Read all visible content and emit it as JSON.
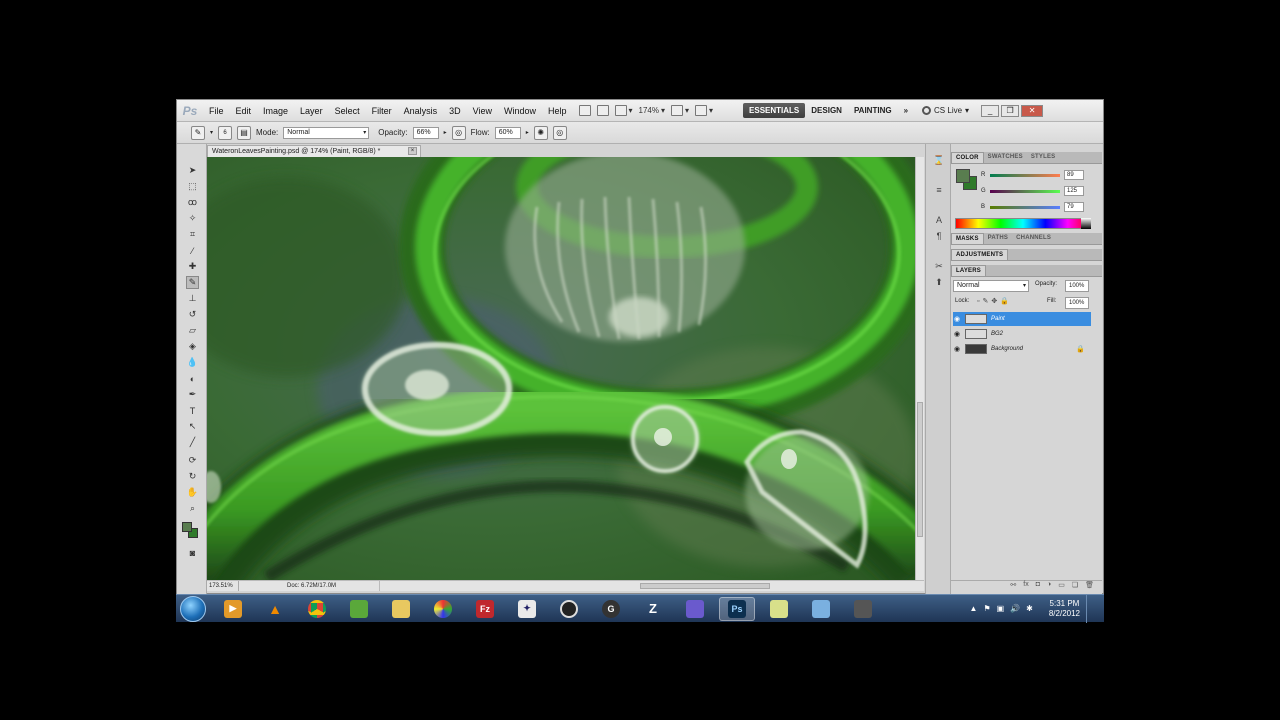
{
  "menu": {
    "logo": "Ps",
    "items": [
      "File",
      "Edit",
      "Image",
      "Layer",
      "Select",
      "Filter",
      "Analysis",
      "3D",
      "View",
      "Window",
      "Help"
    ],
    "zoom": "174%",
    "workspaces": [
      "ESSENTIALS",
      "DESIGN",
      "PAINTING"
    ],
    "more": "»",
    "cs_live": "CS Live"
  },
  "options": {
    "brush_size": "6",
    "mode_label": "Mode:",
    "mode_value": "Normal",
    "opacity_label": "Opacity:",
    "opacity_value": "66%",
    "flow_label": "Flow:",
    "flow_value": "60%"
  },
  "document": {
    "tab_title": "WateronLeavesPainting.psd @ 174% (Paint, RGB/8) *",
    "zoom_status": "173.51%",
    "doc_size": "Doc: 6.72M/17.0M"
  },
  "color_panel": {
    "tabs": [
      "COLOR",
      "SWATCHES",
      "STYLES"
    ],
    "foreground_color": "#597d4f",
    "background_color": "#2f7a2a",
    "channels": [
      {
        "label": "R",
        "value": "89"
      },
      {
        "label": "G",
        "value": "125"
      },
      {
        "label": "B",
        "value": "79"
      }
    ]
  },
  "masks_panel": {
    "tabs": [
      "MASKS",
      "PATHS",
      "CHANNELS"
    ]
  },
  "adjustments_panel": {
    "title": "ADJUSTMENTS"
  },
  "layers_panel": {
    "title": "LAYERS",
    "blend_mode": "Normal",
    "opacity_label": "Opacity:",
    "opacity_value": "100%",
    "lock_label": "Lock:",
    "fill_label": "Fill:",
    "fill_value": "100%",
    "layers": [
      {
        "name": "Paint",
        "selected": true
      },
      {
        "name": "BG2",
        "selected": false
      },
      {
        "name": "Background",
        "selected": false,
        "locked": true
      }
    ]
  },
  "taskbar": {
    "apps": [
      "media-player",
      "vlc",
      "chrome",
      "green-app",
      "folder",
      "color-app",
      "filezilla",
      "app-8",
      "app-9",
      "app-10",
      "app-11",
      "app-12",
      "photoshop",
      "sticky-notes",
      "picture-viewer",
      "app-16"
    ],
    "photoshop_label": "Ps",
    "filezilla_label": "Fz",
    "time": "5:31 PM",
    "date": "8/2/2012"
  },
  "colors": {
    "accent_selected": "#3a8de0",
    "active_workspace": "#4a4a4a",
    "taskbar": "#2a4468"
  }
}
